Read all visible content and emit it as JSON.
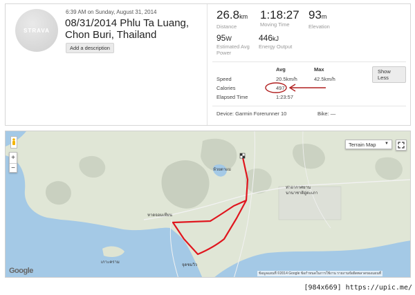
{
  "activity": {
    "avatar_text": "STRAVA",
    "date": "6:39 AM on Sunday, August 31, 2014",
    "title": "08/31/2014 Phlu Ta Luang, Chon Buri, Thailand",
    "add_description": "Add a description"
  },
  "stats": {
    "distance": {
      "value": "26.8",
      "unit": "km",
      "label": "Distance"
    },
    "moving_time": {
      "value": "1:18:27",
      "label": "Moving Time"
    },
    "elevation": {
      "value": "93",
      "unit": "m",
      "label": "Elevation"
    },
    "power": {
      "value": "95",
      "unit": "W",
      "label_line1": "Estimated Avg",
      "label_line2": "Power"
    },
    "energy": {
      "value": "446",
      "unit": "kJ",
      "label": "Energy Output"
    }
  },
  "details": {
    "show_less": "Show Less",
    "col_avg": "Avg",
    "col_max": "Max",
    "speed_label": "Speed",
    "speed_avg": "20.5km/h",
    "speed_max": "42.5km/h",
    "calories_label": "Calories",
    "calories_avg": "497",
    "elapsed_label": "Elapsed Time",
    "elapsed_avg": "1:23:57",
    "device": "Device: Garmin Forerunner 10",
    "bike": "Bike: —"
  },
  "map": {
    "map_type": "Terrain Map",
    "zoom_in": "+",
    "zoom_out": "−",
    "google": "Google",
    "attribution": "ข้อมูลแผนที่ ©2014 Google   ข้อกำหนดในการใช้งาน   รายงานข้อผิดพลาดของแผนที่",
    "labels": {
      "lake": "ห้วยตาแม",
      "navy_line1": "ท่าอากาศยาน",
      "navy_line2": "นานาชาติอู่ตะเภา",
      "town": "หาดจอมเทียน",
      "island": "เกาะคราม",
      "chumsai": "จุดชมวิว"
    },
    "colors": {
      "route": "#e0161e",
      "sea": "#a4c9e6",
      "land": "#e0e6d6"
    }
  },
  "watermark": "[984x669] https://upic.me/"
}
